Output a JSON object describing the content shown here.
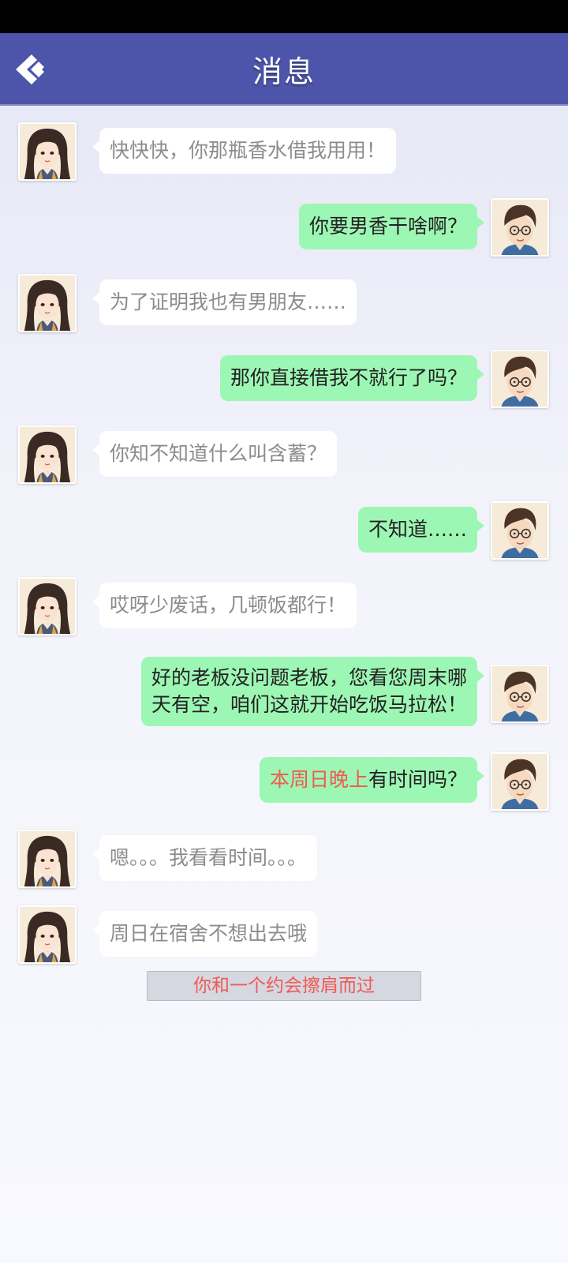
{
  "header": {
    "title": "消息",
    "back_icon": "back-chevron-icon"
  },
  "messages": [
    {
      "from": "her",
      "text": "快快快，你那瓶香水借我用用！"
    },
    {
      "from": "me",
      "text": "你要男香干啥啊？"
    },
    {
      "from": "her",
      "text": "为了证明我也有男朋友……"
    },
    {
      "from": "me",
      "text": "那你直接借我不就行了吗？"
    },
    {
      "from": "her",
      "text": "你知不知道什么叫含蓄？"
    },
    {
      "from": "me",
      "text": "不知道……"
    },
    {
      "from": "her",
      "text": "哎呀少废话，几顿饭都行！"
    },
    {
      "from": "me",
      "line1": "好的老板没问题老板，您看您周末哪",
      "line2": "天有空，咱们这就开始吃饭马拉松！"
    },
    {
      "from": "me",
      "highlight": "本周日晚上",
      "rest": "有时间吗？"
    },
    {
      "from": "her",
      "text": "嗯。。。我看看时间。。。"
    },
    {
      "from": "her",
      "text": "周日在宿舍不想出去哦"
    }
  ],
  "notice": "你和一个约会擦肩而过",
  "colors": {
    "header_bg": "#4c55a9",
    "my_bubble": "#9df7b4",
    "her_bubble": "#ffffff",
    "highlight": "#f05a52"
  }
}
